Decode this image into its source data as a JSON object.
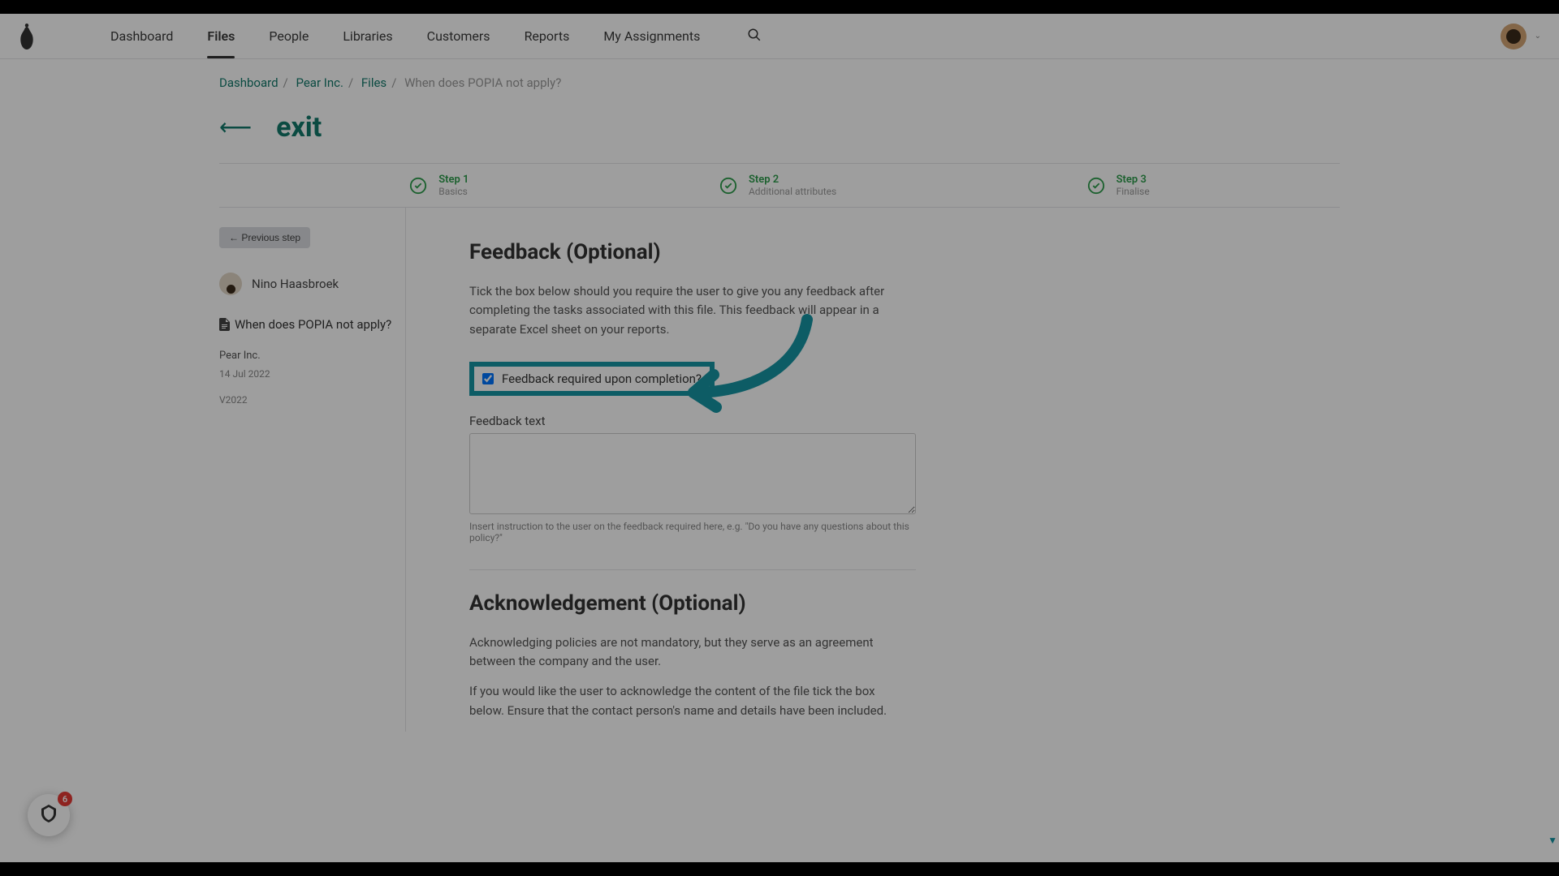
{
  "nav": {
    "items": [
      "Dashboard",
      "Files",
      "People",
      "Libraries",
      "Customers",
      "Reports",
      "My Assignments"
    ],
    "active": "Files"
  },
  "breadcrumb": {
    "parts": [
      "Dashboard",
      "Pear Inc.",
      "Files"
    ],
    "current": "When does POPIA not apply?"
  },
  "page": {
    "title": "exit"
  },
  "steps": [
    {
      "title": "Step 1",
      "desc": "Basics"
    },
    {
      "title": "Step 2",
      "desc": "Additional attributes"
    },
    {
      "title": "Step 3",
      "desc": "Finalise"
    }
  ],
  "sidebar": {
    "prev_label": "← Previous step",
    "author": "Nino Haasbroek",
    "file_title": "When does POPIA not apply?",
    "company": "Pear Inc.",
    "date": "14 Jul 2022",
    "version": "V2022"
  },
  "feedback": {
    "heading": "Feedback (Optional)",
    "intro": "Tick the box below should you require the user to give you any feedback after completing the tasks associated with this file. This feedback will appear in a separate Excel sheet on your reports.",
    "checkbox_label": "Feedback required upon completion?",
    "checked": true,
    "textarea_label": "Feedback text",
    "textarea_value": "",
    "hint": "Insert instruction to the user on the feedback required here, e.g. \"Do you have any questions about this policy?\""
  },
  "ack": {
    "heading": "Acknowledgement (Optional)",
    "p1": "Acknowledging policies are not mandatory, but they serve as an agreement between the company and the user.",
    "p2": "If you would like the user to acknowledge the content of the file tick the box below. Ensure that the contact person's name and details have been included."
  },
  "badge": {
    "count": "6"
  },
  "colors": {
    "accent": "#137a6b",
    "step_green": "#2e9d4c",
    "highlight": "#1695a3"
  }
}
